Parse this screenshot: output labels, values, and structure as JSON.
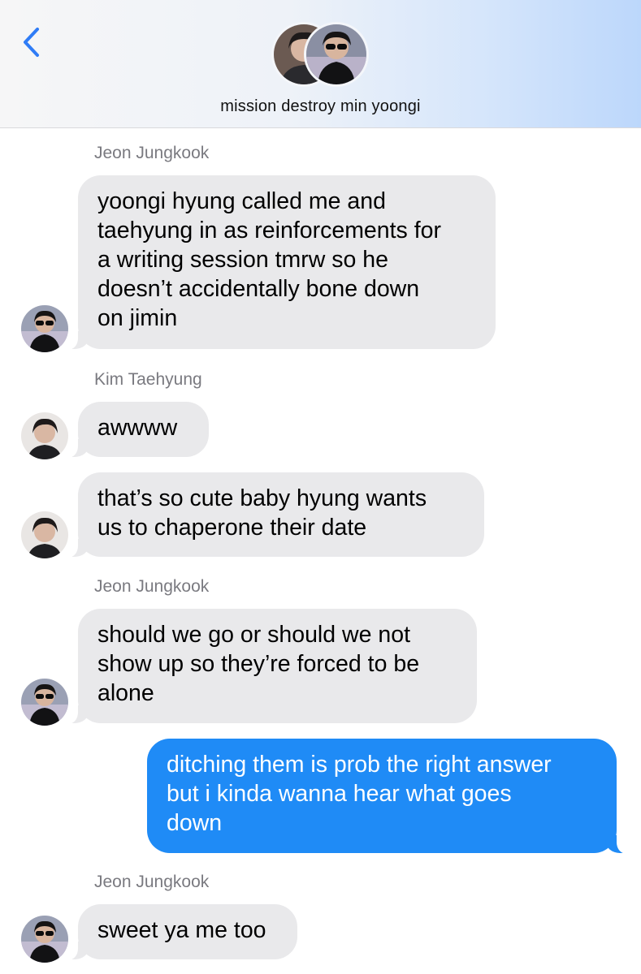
{
  "header": {
    "title": "mission destroy min yoongi",
    "back_icon": "chevron-left-icon",
    "accent_color": "#2f7cf6"
  },
  "messages": [
    {
      "sender": "Jeon Jungkook",
      "text": "yoongi hyung called me and\ntaehyung in as reinforcements for\na writing session tmrw so he\ndoesn’t accidentally bone down\non jimin"
    },
    {
      "sender": "Kim Taehyung",
      "text": "awwww"
    },
    {
      "text": "that’s so cute baby hyung wants\nus to chaperone their date"
    },
    {
      "sender": "Jeon Jungkook",
      "text": "should we go or should we not\nshow up so they’re forced to be\nalone"
    },
    {
      "text": "ditching them is prob the right answer\nbut i kinda wanna hear what goes\ndown"
    },
    {
      "sender": "Jeon Jungkook",
      "text": "sweet ya me too"
    }
  ],
  "colors": {
    "incoming_bubble": "#e9e9eb",
    "outgoing_bubble": "#1f8bf6",
    "sender_label": "#7a7a80"
  }
}
